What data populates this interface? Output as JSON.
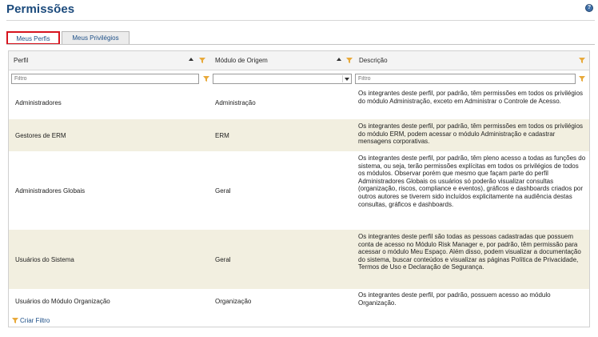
{
  "page": {
    "title": "Permissões"
  },
  "tabs": [
    {
      "label": "Meus Perfis",
      "active": true
    },
    {
      "label": "Meus Privilégios",
      "active": false
    }
  ],
  "grid": {
    "columns": [
      {
        "label": "Perfil",
        "sortable": true,
        "filterable": true
      },
      {
        "label": "Módulo de Origem",
        "sortable": true,
        "filterable": true
      },
      {
        "label": "Descrição",
        "sortable": false,
        "filterable": true
      }
    ],
    "filters": {
      "profile_placeholder": "Filtro",
      "module_value": "",
      "description_placeholder": "Filtro"
    },
    "rows": [
      {
        "profile": "Administradores",
        "module": "Administração",
        "description": "Os integrantes deste perfil, por padrão, têm permissões em todos os privilégios do módulo Administração, exceto em Administrar o Controle de Acesso."
      },
      {
        "profile": "Gestores de ERM",
        "module": "ERM",
        "description": "Os integrantes deste perfil, por padrão, têm permissões em todos os privilégios do módulo ERM, podem acessar o módulo Administração e cadastrar mensagens corporativas."
      },
      {
        "profile": "Administradores Globais",
        "module": "Geral",
        "description": "Os integrantes deste perfil, por padrão, têm pleno acesso a todas as funções do sistema, ou seja, terão permissões explícitas em todos os privilégios de todos os módulos. Observar porém que mesmo que façam parte do perfil Administradores Globais os usuários só poderão visualizar consultas (organização, riscos, compliance e eventos), gráficos e dashboards criados por outros autores se tiverem sido incluídos explicitamente na audiência destas consultas, gráficos e dashboards."
      },
      {
        "profile": "Usuários do Sistema",
        "module": "Geral",
        "description": "Os integrantes deste perfil são todas as pessoas cadastradas que possuem conta de acesso no Módulo Risk Manager e, por padrão, têm permissão para acessar o módulo Meu Espaço. Além disso, podem visualizar a documentação do sistema, buscar conteúdos e visualizar as páginas Política de Privacidade, Termos de Uso e Declaração de Segurança."
      },
      {
        "profile": "Usuários do Módulo Organização",
        "module": "Organização",
        "description": "Os integrantes deste perfil, por padrão, possuem acesso ao módulo Organização."
      }
    ]
  },
  "footer": {
    "create_filter_label": "Criar Filtro"
  },
  "colors": {
    "title": "#1b4a7c",
    "link": "#1d4f87",
    "active_tab_border": "#d7141e",
    "row_alt": "#f2efe0",
    "funnel": "#e8a93a"
  },
  "icons": {
    "help": "help-icon",
    "sort": "sort-asc-icon",
    "filter": "funnel-icon",
    "dropdown": "chevron-down-icon"
  }
}
